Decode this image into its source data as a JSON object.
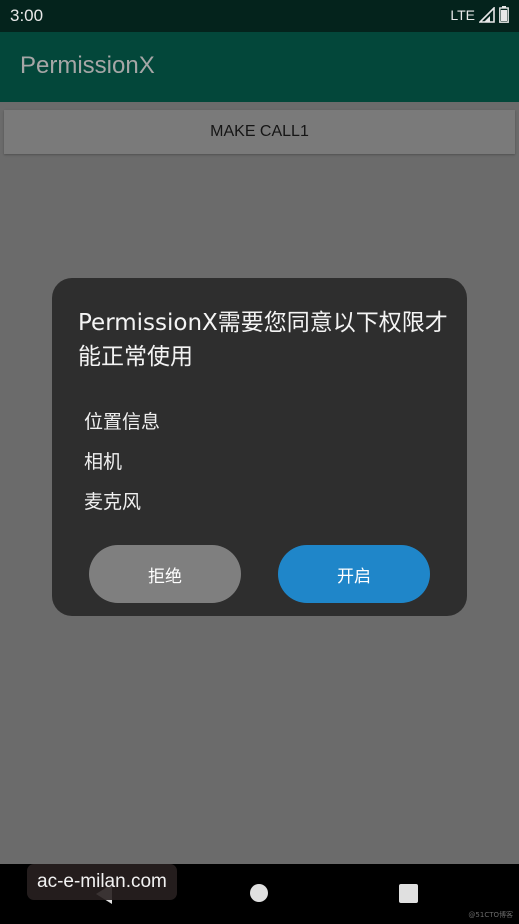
{
  "status_bar": {
    "time": "3:00",
    "network": "LTE"
  },
  "app_bar": {
    "title": "PermissionX"
  },
  "main": {
    "make_call_label": "MAKE CALL1"
  },
  "dialog": {
    "title": "PermissionX需要您同意以下权限才能正常使用",
    "permissions": [
      "位置信息",
      "相机",
      "麦克风"
    ],
    "deny_label": "拒绝",
    "allow_label": "开启"
  },
  "overlay": {
    "watermark": "ac-e-milan.com",
    "corner_mark": "@51CTO博客"
  },
  "colors": {
    "status_bar": "#04231c",
    "app_bar": "#03473a",
    "scrim": "#6b6b6b",
    "dialog": "#2e2e2e",
    "deny_button": "#7f7f7f",
    "allow_button": "#1f86c9"
  },
  "icons": [
    "signal-icon",
    "battery-icon",
    "back-icon",
    "home-icon",
    "recents-icon"
  ]
}
